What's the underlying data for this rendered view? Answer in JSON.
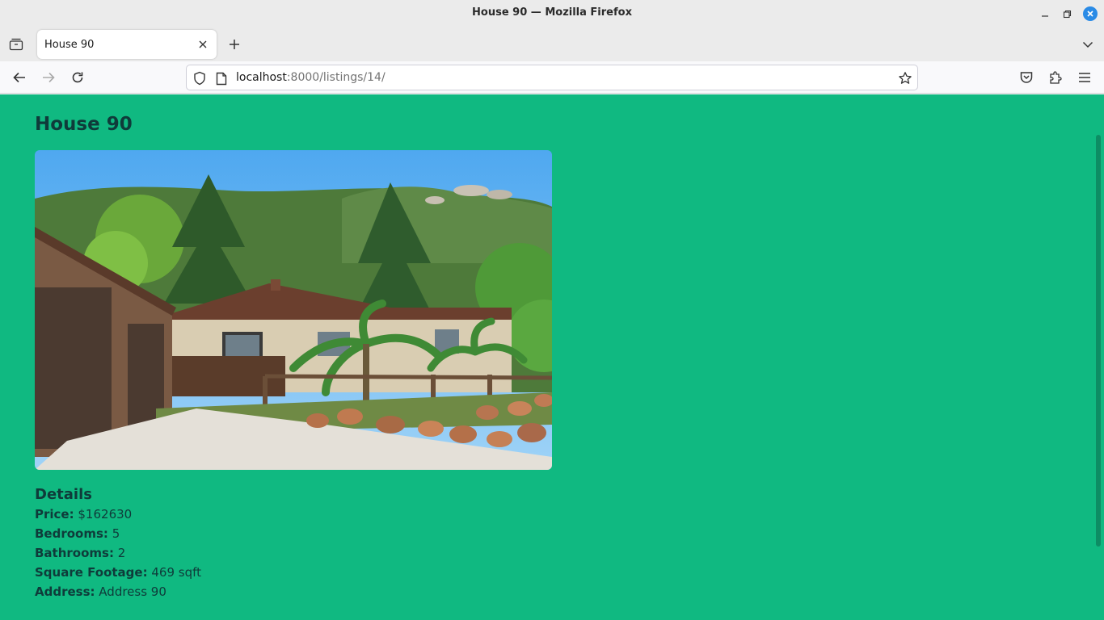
{
  "window": {
    "title": "House 90 — Mozilla Firefox"
  },
  "tabs": [
    {
      "label": "House 90"
    }
  ],
  "navbar": {
    "url_host": "localhost",
    "url_rest": ":8000/listings/14/"
  },
  "page": {
    "title": "House 90",
    "photo_icon": "house-photo",
    "details_heading": "Details",
    "details": {
      "price_label": "Price:",
      "price_value": "$162630",
      "bedrooms_label": "Bedrooms:",
      "bedrooms_value": "5",
      "bathrooms_label": "Bathrooms:",
      "bathrooms_value": "2",
      "sqft_label": "Square Footage:",
      "sqft_value": "469 sqft",
      "address_label": "Address:",
      "address_value": "Address 90"
    }
  },
  "colors": {
    "page_background": "#10b981",
    "text": "#0f3b3a",
    "accent": "#2a8be6"
  },
  "icons": {
    "tab_list": "tab-list-icon",
    "tab_close": "close-icon",
    "new_tab": "plus-icon",
    "tab_overflow": "chevron-down-icon",
    "back": "arrow-left-icon",
    "forward": "arrow-right-icon",
    "reload": "reload-icon",
    "shield": "shield-icon",
    "page": "page-icon",
    "bookmark": "star-icon",
    "pocket": "pocket-icon",
    "extensions": "puzzle-icon",
    "menu": "hamburger-icon"
  }
}
